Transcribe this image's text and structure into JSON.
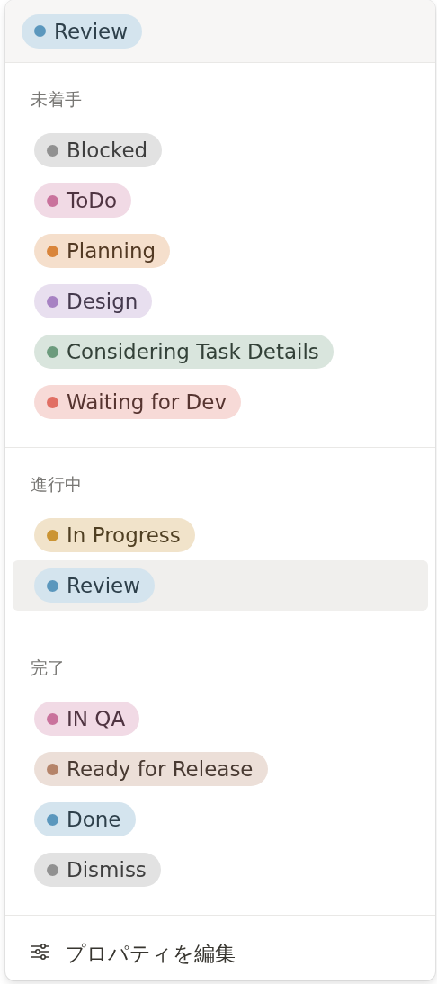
{
  "current": {
    "label": "Review",
    "color": "#5b97bd"
  },
  "groups": [
    {
      "title": "未着手",
      "options": [
        {
          "label": "Blocked",
          "color": "#919191",
          "selected": false
        },
        {
          "label": "ToDo",
          "color": "#c9729c",
          "selected": false
        },
        {
          "label": "Planning",
          "color": "#d9853b",
          "selected": false
        },
        {
          "label": "Design",
          "color": "#a782c3",
          "selected": false
        },
        {
          "label": "Considering Task Details",
          "color": "#6c9b7d",
          "selected": false
        },
        {
          "label": "Waiting for Dev",
          "color": "#e16f64",
          "selected": false
        }
      ]
    },
    {
      "title": "進行中",
      "options": [
        {
          "label": "In Progress",
          "color": "#cb9433",
          "selected": false
        },
        {
          "label": "Review",
          "color": "#5b97bd",
          "selected": true
        }
      ]
    },
    {
      "title": "完了",
      "options": [
        {
          "label": "IN QA",
          "color": "#c9729c",
          "selected": false
        },
        {
          "label": "Ready for Release",
          "color": "#b5846a",
          "selected": false
        },
        {
          "label": "Done",
          "color": "#5b97bd",
          "selected": false
        },
        {
          "label": "Dismiss",
          "color": "#919191",
          "selected": false
        }
      ]
    }
  ],
  "footer": {
    "label": "プロパティを編集"
  }
}
